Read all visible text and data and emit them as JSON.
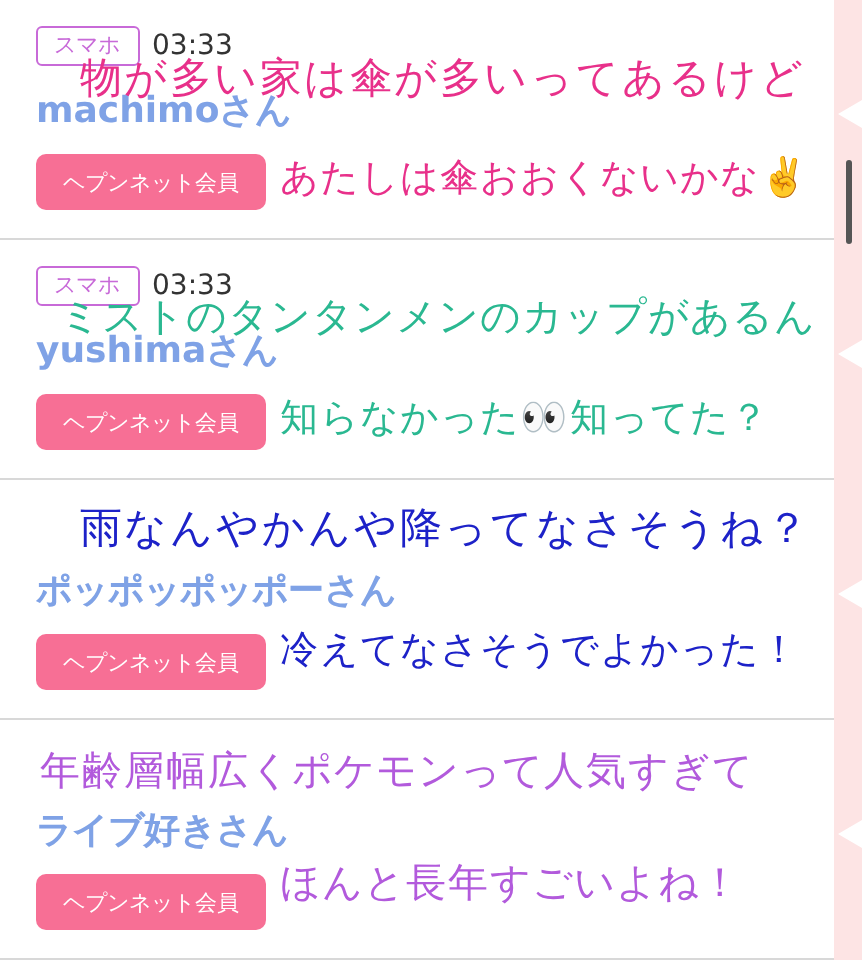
{
  "posts": [
    {
      "device": "スマホ",
      "time": "03:33",
      "user": "machimoさん",
      "member_button": "ヘプンネット会員",
      "caption": {
        "color": "#e8308a",
        "lines": [
          "物が多い家は傘が多いってあるけど",
          "あたしは傘おおくないかな✌️"
        ]
      }
    },
    {
      "device": "スマホ",
      "time": "03:33",
      "user": "yushimaさん",
      "member_button": "ヘプンネット会員",
      "caption": {
        "color": "#2ab891",
        "lines": [
          "ミストのタンタンメンのカップがあるん",
          "知らなかった👀知ってた？"
        ]
      }
    },
    {
      "user": "ポッポッポッポーさん",
      "member_button": "ヘプンネット会員",
      "caption": {
        "color": "#1d22c8",
        "lines": [
          "雨なんやかんや降ってなさそうね？",
          "冷えてなさそうでよかった！"
        ]
      }
    },
    {
      "user": "ライブ好きさん",
      "member_button": "ヘプンネット会員",
      "caption": {
        "color": "#b25adc",
        "lines": [
          "年齢層幅広くポケモンって人気すぎて",
          "ほんと長年すごいよね！"
        ]
      }
    }
  ]
}
